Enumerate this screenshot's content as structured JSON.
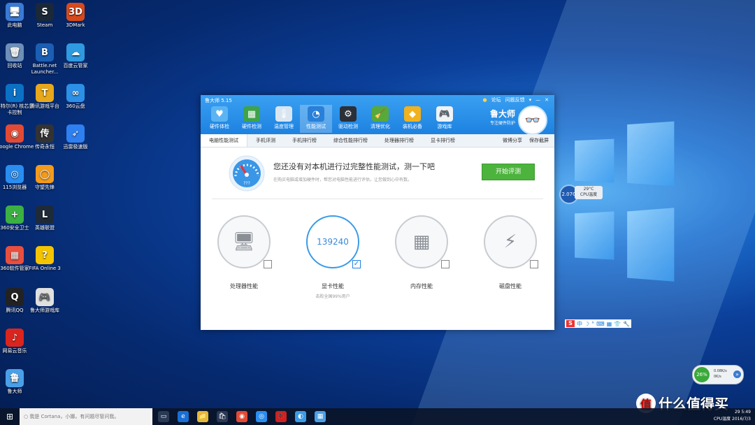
{
  "desktop_icons": [
    {
      "label": "此电脑",
      "glyph": "🖥",
      "bg": "#3a7bd5"
    },
    {
      "label": "Steam",
      "glyph": "S",
      "bg": "#1b2838"
    },
    {
      "label": "3DMark",
      "glyph": "3D",
      "bg": "#d8491b"
    },
    {
      "label": "回收站",
      "glyph": "🗑",
      "bg": "#6e8fb8"
    },
    {
      "label": "Battle.net Launcher...",
      "glyph": "B",
      "bg": "#1b5fb4"
    },
    {
      "label": "百度云管家",
      "glyph": "☁",
      "bg": "#2f9ae0"
    },
    {
      "label": "英特尔(R) 核芯显卡控制",
      "glyph": "i",
      "bg": "#0b71c5"
    },
    {
      "label": "腾讯游戏平台",
      "glyph": "T",
      "bg": "#e8a81b"
    },
    {
      "label": "360云盘",
      "glyph": "∞",
      "bg": "#2b90e6"
    },
    {
      "label": "Google Chrome",
      "glyph": "◉",
      "bg": "#e34a35"
    },
    {
      "label": "传奇永恒",
      "glyph": "传",
      "bg": "#333"
    },
    {
      "label": "迅雷极速版",
      "glyph": "➶",
      "bg": "#2e7ff0"
    },
    {
      "label": "115浏览器",
      "glyph": "◎",
      "bg": "#2a8ef0"
    },
    {
      "label": "守望先锋",
      "glyph": "◯",
      "bg": "#f29b1d"
    },
    {
      "label": "360安全卫士",
      "glyph": "+",
      "bg": "#3cb043"
    },
    {
      "label": "英雄联盟",
      "glyph": "L",
      "bg": "#1e2a38"
    },
    {
      "label": "360软件管家",
      "glyph": "▦",
      "bg": "#e94f3f"
    },
    {
      "label": "FIFA Online 3",
      "glyph": "?",
      "bg": "#f5c400"
    },
    {
      "label": "腾讯QQ",
      "glyph": "Q",
      "bg": "#222"
    },
    {
      "label": "鲁大师游戏库",
      "glyph": "🎮",
      "bg": "#e0e0e0"
    },
    {
      "label": "网易云音乐",
      "glyph": "♪",
      "bg": "#d9251e"
    },
    {
      "label": "鲁大师",
      "glyph": "鲁",
      "bg": "#4aa0e8"
    }
  ],
  "window": {
    "title": "鲁大师 5.15",
    "links": [
      "论坛",
      "问题反馈"
    ],
    "controls": [
      "▾",
      "—",
      "✕"
    ],
    "tools": [
      {
        "label": "硬件体检",
        "glyph": "♥",
        "bg": "#5ab4f3"
      },
      {
        "label": "硬件检测",
        "glyph": "▦",
        "bg": "#3ea34a"
      },
      {
        "label": "温度管理",
        "glyph": "🌡",
        "bg": "#d9e6f2"
      },
      {
        "label": "性能测试",
        "glyph": "◔",
        "bg": "#2a80d8"
      },
      {
        "label": "驱动检测",
        "glyph": "⚙",
        "bg": "#2b2f38"
      },
      {
        "label": "清理优化",
        "glyph": "🧹",
        "bg": "#58a93a"
      },
      {
        "label": "装机必备",
        "glyph": "◆",
        "bg": "#f0b21e"
      },
      {
        "label": "游戏库",
        "glyph": "🎮",
        "bg": "#eef3f8"
      }
    ],
    "brand_name": "鲁大师",
    "brand_slogan": "专注硬件防护",
    "subtabs": [
      "电脑性能测试",
      "手机评测",
      "手机排行榜",
      "综合性能排行榜",
      "处理器排行榜",
      "显卡排行榜"
    ],
    "share": "微博分享",
    "save": "保存截屏",
    "banner_headline": "您还没有对本机进行过完整性能测试，测一下吧",
    "banner_sub": "在购买电脑或增加硬件时，帮您对电脑性能进行评估，让您做到心中有数。",
    "gauge_text": "???",
    "start_button": "开始评测",
    "cards": [
      {
        "label": "处理器性能",
        "glyph": "🖥",
        "note": "",
        "score": "",
        "checked": false,
        "active": false
      },
      {
        "label": "显卡性能",
        "glyph": "",
        "note": "击败全国99%用户",
        "score": "139240",
        "checked": true,
        "active": true
      },
      {
        "label": "内存性能",
        "glyph": "▦",
        "note": "",
        "score": "",
        "checked": false,
        "active": false
      },
      {
        "label": "磁盘性能",
        "glyph": "⚡",
        "note": "",
        "score": "",
        "checked": false,
        "active": false
      }
    ]
  },
  "cpu_gadget": {
    "freq": "2.07G",
    "temp": "29°C",
    "label": "CPU温度"
  },
  "ime": {
    "items": [
      "S",
      "中",
      "☽",
      "°",
      "⌨",
      "▦",
      "👕",
      "🔧"
    ]
  },
  "net_widget": {
    "percent": "26%",
    "up": "0.08K/s",
    "down": "0K/s"
  },
  "taskbar": {
    "search_placeholder": "我是 Cortana，小娜。有问题尽管问我。",
    "apps": [
      "▭",
      "e",
      "📁",
      "🛍",
      "◉",
      "◎",
      "🐞",
      "◐",
      "▦"
    ],
    "tray_temp": "29",
    "tray_label": "CPU温度",
    "time": "5:49",
    "date": "2016/7/3"
  },
  "watermark": {
    "icon": "值",
    "text": "什么值得买"
  }
}
